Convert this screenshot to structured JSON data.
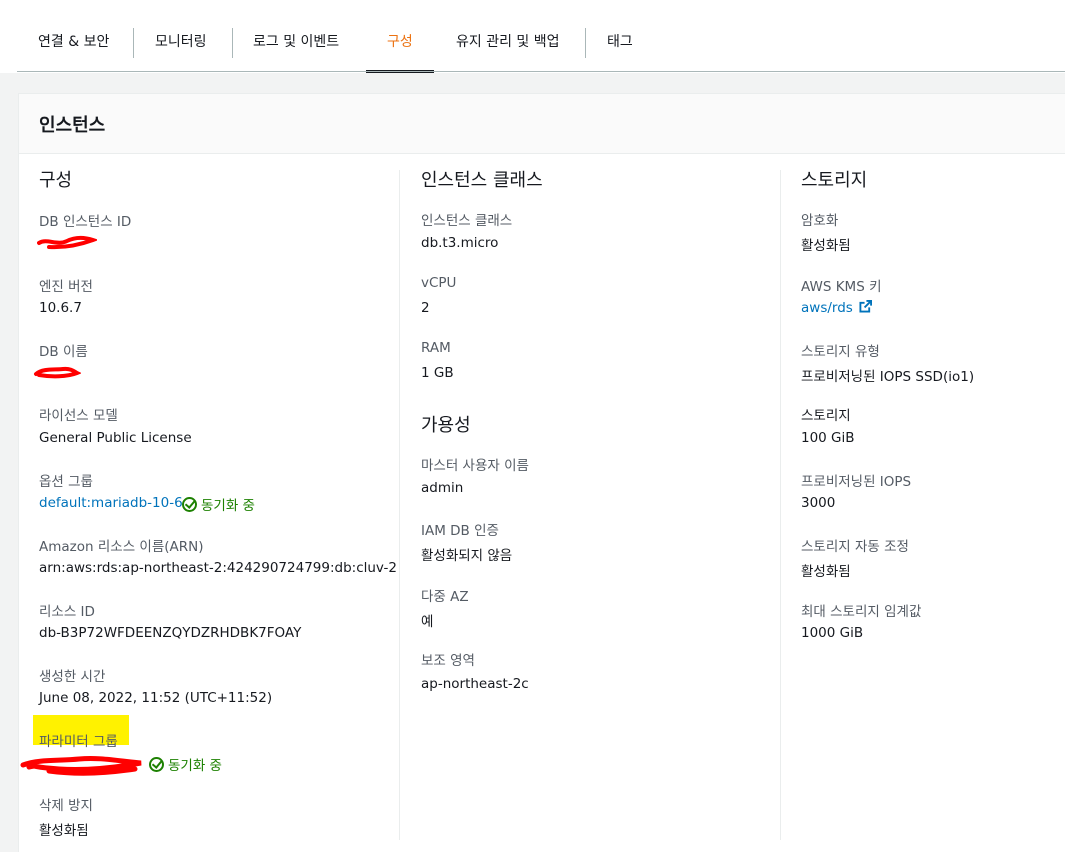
{
  "tabs": [
    {
      "label": "연결 & 보안",
      "active": false
    },
    {
      "label": "모니터링",
      "active": false
    },
    {
      "label": "로그 및 이벤트",
      "active": false
    },
    {
      "label": "구성",
      "active": true
    },
    {
      "label": "유지 관리 및 백업",
      "active": false
    },
    {
      "label": "태그",
      "active": false
    }
  ],
  "panel": {
    "title": "인스턴스"
  },
  "col1": {
    "section_title": "구성",
    "instance_id_label": "DB 인스턴스 ID",
    "engine_version_label": "엔진 버전",
    "engine_version_value": "10.6.7",
    "db_name_label": "DB 이름",
    "license_label": "라이선스 모델",
    "license_value": "General Public License",
    "option_group_label": "옵션 그룹",
    "option_group_value": "default:mariadb-10-6",
    "option_group_status": "동기화 중",
    "arn_label": "Amazon 리소스 이름(ARN)",
    "arn_value": "arn:aws:rds:ap-northeast-2:424290724799:db:cluv-2",
    "resource_id_label": "리소스 ID",
    "resource_id_value": "db-B3P72WFDEENZQYDZRHDBK7FOAY",
    "created_label": "생성한 시간",
    "created_value": "June 08, 2022, 11:52 (UTC+11:52)",
    "param_group_label": "파라미터 그룹",
    "param_group_status": "동기화 중",
    "deletion_protection_label": "삭제 방지",
    "deletion_protection_value": "활성화됨"
  },
  "col2": {
    "section_title": "인스턴스 클래스",
    "class_label": "인스턴스 클래스",
    "class_value": "db.t3.micro",
    "vcpu_label": "vCPU",
    "vcpu_value": "2",
    "ram_label": "RAM",
    "ram_value": "1 GB",
    "availability_title": "가용성",
    "master_user_label": "마스터 사용자 이름",
    "master_user_value": "admin",
    "iam_label": "IAM DB 인증",
    "iam_value": "활성화되지 않음",
    "multi_az_label": "다중 AZ",
    "multi_az_value": "예",
    "secondary_zone_label": "보조 영역",
    "secondary_zone_value": "ap-northeast-2c"
  },
  "col3": {
    "section_title": "스토리지",
    "encryption_label": "암호화",
    "encryption_value": "활성화됨",
    "kms_label": "AWS KMS 키",
    "kms_value": "aws/rds",
    "storage_type_label": "스토리지 유형",
    "storage_type_value": "프로비저닝된 IOPS SSD(io1)",
    "storage_label": "스토리지",
    "storage_value": "100 GiB",
    "iops_label": "프로비저닝된 IOPS",
    "iops_value": "3000",
    "autoscaling_label": "스토리지 자동 조정",
    "autoscaling_value": "활성화됨",
    "max_threshold_label": "최대 스토리지 임계값",
    "max_threshold_value": "1000 GiB"
  },
  "colors": {
    "active_tab": "#ec7211",
    "link": "#0073bb",
    "status_green": "#1d8102",
    "highlight": "#fff200",
    "redaction": "#ff0000"
  },
  "icons": {
    "status": "check-circle-icon",
    "external_link": "external-link-icon"
  }
}
